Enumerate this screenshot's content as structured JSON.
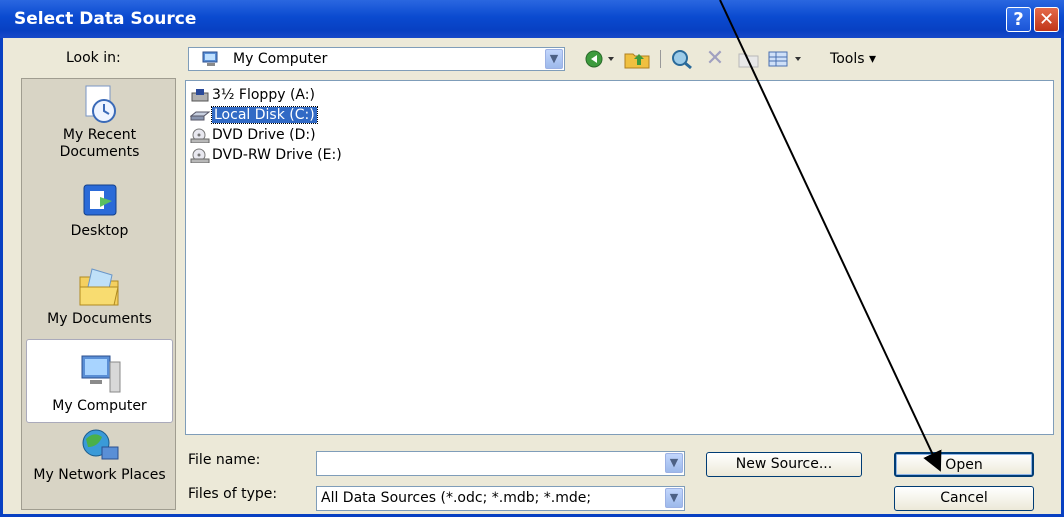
{
  "window": {
    "title": "Select Data Source",
    "help_label": "?",
    "close_label": "✕"
  },
  "lookin": {
    "label": "Look in:",
    "value": "My Computer"
  },
  "toolbar": {
    "tools_label": "Tools ▾"
  },
  "places": [
    {
      "label": "My Recent Documents",
      "icon": "recent-documents-icon"
    },
    {
      "label": "Desktop",
      "icon": "desktop-icon"
    },
    {
      "label": "My Documents",
      "icon": "my-documents-icon"
    },
    {
      "label": "My Computer",
      "icon": "my-computer-icon",
      "selected": true
    },
    {
      "label": "My Network Places",
      "icon": "network-places-icon"
    }
  ],
  "files": [
    {
      "name": "3½ Floppy (A:)",
      "icon": "floppy-drive-icon"
    },
    {
      "name": "Local Disk (C:)",
      "icon": "hard-disk-icon",
      "selected": true
    },
    {
      "name": "DVD Drive (D:)",
      "icon": "dvd-drive-icon"
    },
    {
      "name": "DVD-RW Drive (E:)",
      "icon": "dvd-rw-drive-icon"
    }
  ],
  "filename": {
    "label": "File name:",
    "value": ""
  },
  "filetype": {
    "label": "Files of type:",
    "value": "All Data Sources (*.odc; *.mdb; *.mde;"
  },
  "buttons": {
    "new_source": "New Source...",
    "open": "Open",
    "cancel": "Cancel"
  },
  "colors": {
    "titlebar": "#0a4ad0",
    "selection": "#316ac5",
    "dialog_bg": "#ece9d8"
  }
}
